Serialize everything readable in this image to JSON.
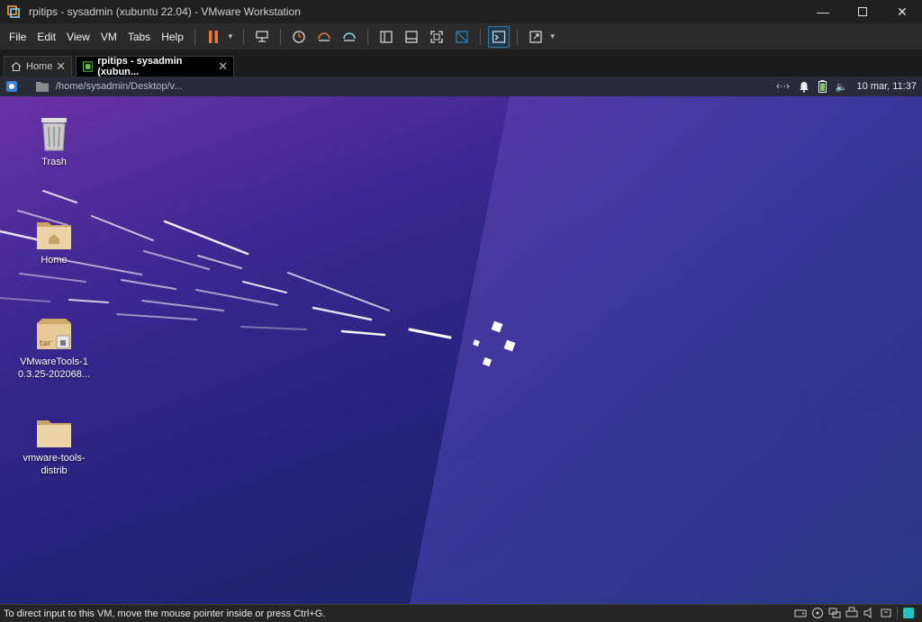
{
  "window": {
    "title": "rpitips - sysadmin (xubuntu 22.04) - VMware Workstation",
    "minimize_icon": "minimize-icon",
    "maximize_icon": "maximize-icon",
    "close_icon": "close-icon"
  },
  "menu": [
    "File",
    "Edit",
    "View",
    "VM",
    "Tabs",
    "Help"
  ],
  "tabs": [
    {
      "label": "Home",
      "icon": "home-icon"
    },
    {
      "label": "rpitips - sysadmin (xubun...",
      "icon": "vm-icon"
    }
  ],
  "guest_panel": {
    "path": "/home/sysadmin/Desktop/v...",
    "clock": "10 mar, 11:37"
  },
  "desktop_icons": [
    {
      "label": "Trash",
      "icon": "trash-icon"
    },
    {
      "label": "Home",
      "icon": "home-folder-icon"
    },
    {
      "label": "VMwareTools-1\n0.3.25-202068...",
      "icon": "archive-icon"
    },
    {
      "label": "vmware-tools-\ndistrib",
      "icon": "folder-icon"
    }
  ],
  "status_bar": {
    "message": "To direct input to this VM, move the mouse pointer inside or press Ctrl+G."
  },
  "colors": {
    "accent_orange": "#e8773a",
    "accent_blue": "#2e7cb2",
    "status_teal": "#21c4c4"
  }
}
